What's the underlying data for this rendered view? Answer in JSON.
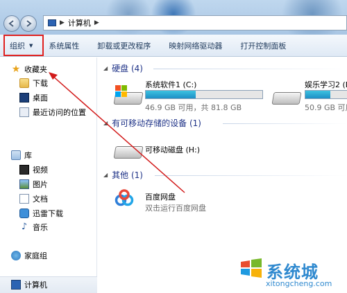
{
  "address": {
    "crumb": "计算机"
  },
  "toolbar": {
    "organize": "组织",
    "system_properties": "系统属性",
    "uninstall": "卸载或更改程序",
    "map_drive": "映射网络驱动器",
    "control_panel": "打开控制面板"
  },
  "sidebar": {
    "favorites": "收藏夹",
    "downloads": "下载",
    "desktop": "桌面",
    "recent": "最近访问的位置",
    "libraries": "库",
    "videos": "视频",
    "pictures": "图片",
    "documents": "文档",
    "thunder": "迅雷下载",
    "music": "音乐",
    "homegroup": "家庭组",
    "computer": "计算机"
  },
  "main": {
    "hdd_group": "硬盘 (4)",
    "removable_group": "有可移动存储的设备 (1)",
    "other_group": "其他 (1)",
    "drives": [
      {
        "name": "系统软件1 (C:)",
        "info": "46.9 GB 可用，共 81.8 GB",
        "used_fraction": 0.43
      },
      {
        "name": "娱乐学习2 (D",
        "info": "50.9 GB 可用",
        "used_fraction": 0.6
      }
    ],
    "removable": {
      "name": "可移动磁盘 (H:)"
    },
    "baidu": {
      "name": "百度网盘",
      "desc": "双击运行百度网盘"
    }
  },
  "watermark": {
    "text": "系统城",
    "url": "xitongcheng.com"
  },
  "colors": {
    "highlight_box": "#e0201e",
    "accent": "#2f89cf",
    "bar_fill": "#1d8fc6"
  }
}
